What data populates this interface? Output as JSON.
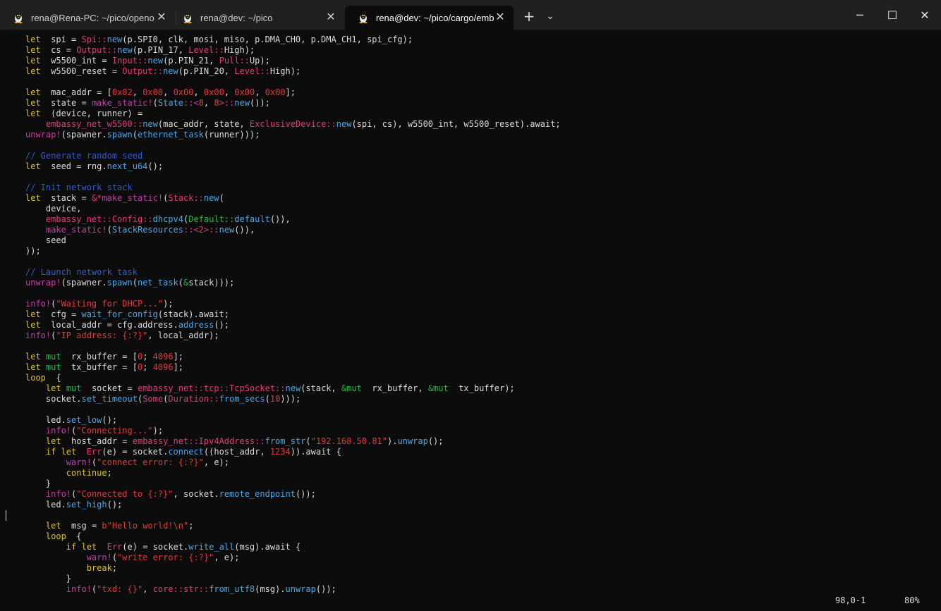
{
  "tabs": [
    {
      "title": "rena@Rena-PC: ~/pico/openo",
      "icon": "linux-penguin-icon",
      "active": false
    },
    {
      "title": "rena@dev: ~/pico",
      "icon": "linux-penguin-icon",
      "active": false
    },
    {
      "title": "rena@dev: ~/pico/cargo/emb",
      "icon": "linux-penguin-icon",
      "active": true
    }
  ],
  "toolbar": {
    "new_tab": "+",
    "dropdown": "⌄"
  },
  "window": {
    "minimize": "─",
    "maximize": "☐",
    "close": "✕"
  },
  "code_lines": [
    [
      [
        "kw",
        "let"
      ],
      [
        "",
        "  spi = "
      ],
      [
        "ty",
        "Spi::"
      ],
      [
        "fn",
        "new"
      ],
      [
        "",
        "(p.SPI0, clk, mosi, miso, p.DMA_CH0, p.DMA_CH1, spi_cfg);"
      ]
    ],
    [
      [
        "kw",
        "let"
      ],
      [
        "",
        "  cs = "
      ],
      [
        "ty",
        "Output::"
      ],
      [
        "fn",
        "new"
      ],
      [
        "",
        "(p.PIN_17, "
      ],
      [
        "ty",
        "Level::"
      ],
      [
        "",
        "High);"
      ]
    ],
    [
      [
        "kw",
        "let"
      ],
      [
        "",
        "  w5500_int = "
      ],
      [
        "ty",
        "Input::"
      ],
      [
        "fn",
        "new"
      ],
      [
        "",
        "(p.PIN_21, "
      ],
      [
        "ty",
        "Pull::"
      ],
      [
        "",
        "Up);"
      ]
    ],
    [
      [
        "kw",
        "let"
      ],
      [
        "",
        "  w5500_reset = "
      ],
      [
        "ty",
        "Output::"
      ],
      [
        "fn",
        "new"
      ],
      [
        "",
        "(p.PIN_20, "
      ],
      [
        "ty",
        "Level::"
      ],
      [
        "",
        "High);"
      ]
    ],
    [],
    [
      [
        "kw",
        "let"
      ],
      [
        "",
        "  mac_addr = ["
      ],
      [
        "num",
        "0x02"
      ],
      [
        "",
        ", "
      ],
      [
        "num",
        "0x00"
      ],
      [
        "",
        ", "
      ],
      [
        "num",
        "0x00"
      ],
      [
        "",
        ", "
      ],
      [
        "num",
        "0x00"
      ],
      [
        "",
        ", "
      ],
      [
        "num",
        "0x00"
      ],
      [
        "",
        ", "
      ],
      [
        "num",
        "0x00"
      ],
      [
        "",
        "];"
      ]
    ],
    [
      [
        "kw",
        "let"
      ],
      [
        "",
        "  state = "
      ],
      [
        "mac",
        "make_static!"
      ],
      [
        "",
        "("
      ],
      [
        "fn",
        "State"
      ],
      [
        "ty",
        "::<"
      ],
      [
        "num",
        "8"
      ],
      [
        "",
        ", "
      ],
      [
        "num",
        "8"
      ],
      [
        "ty",
        ">::"
      ],
      [
        "fn",
        "new"
      ],
      [
        "",
        "());"
      ]
    ],
    [
      [
        "kw",
        "let"
      ],
      [
        "",
        "  (device, runner) ="
      ]
    ],
    [
      [
        "",
        "    "
      ],
      [
        "ty",
        "embassy_net_w5500::"
      ],
      [
        "fn",
        "new"
      ],
      [
        "",
        "(mac_addr, state, "
      ],
      [
        "ty",
        "ExclusiveDevice::"
      ],
      [
        "fn",
        "new"
      ],
      [
        "",
        "(spi, cs), w5500_int, w5500_reset).await;"
      ]
    ],
    [
      [
        "mac",
        "unwrap!"
      ],
      [
        "",
        "(spawner."
      ],
      [
        "fn",
        "spawn"
      ],
      [
        "",
        "("
      ],
      [
        "fn",
        "ethernet_task"
      ],
      [
        "",
        "(runner)));"
      ]
    ],
    [],
    [
      [
        "cm",
        "// Generate random seed"
      ]
    ],
    [
      [
        "kw",
        "let"
      ],
      [
        "",
        "  seed = rng."
      ],
      [
        "fn",
        "next_u64"
      ],
      [
        "",
        "();"
      ]
    ],
    [],
    [
      [
        "cm",
        "// Init network stack"
      ]
    ],
    [
      [
        "kw",
        "let"
      ],
      [
        "",
        "  stack = "
      ],
      [
        "ty",
        "&*"
      ],
      [
        "mac",
        "make_static!"
      ],
      [
        "",
        "("
      ],
      [
        "ty",
        "Stack::"
      ],
      [
        "fn",
        "new"
      ],
      [
        "",
        "("
      ]
    ],
    [
      [
        "",
        "    device,"
      ]
    ],
    [
      [
        "",
        "    "
      ],
      [
        "ty",
        "embassy_net::Config::"
      ],
      [
        "fn",
        "dhcpv4"
      ],
      [
        "",
        "("
      ],
      [
        "grn",
        "Default::"
      ],
      [
        "fn",
        "default"
      ],
      [
        "",
        "()),"
      ]
    ],
    [
      [
        "",
        "    "
      ],
      [
        "mac",
        "make_static!"
      ],
      [
        "",
        "("
      ],
      [
        "fn",
        "StackResources"
      ],
      [
        "ty",
        "::<"
      ],
      [
        "num",
        "2"
      ],
      [
        "ty",
        ">::"
      ],
      [
        "fn",
        "new"
      ],
      [
        "",
        "()),"
      ]
    ],
    [
      [
        "",
        "    seed"
      ]
    ],
    [
      [
        "",
        "));"
      ]
    ],
    [],
    [
      [
        "cm",
        "// Launch network task"
      ]
    ],
    [
      [
        "mac",
        "unwrap!"
      ],
      [
        "",
        "(spawner."
      ],
      [
        "fn",
        "spawn"
      ],
      [
        "",
        "("
      ],
      [
        "fn",
        "net_task"
      ],
      [
        "",
        "("
      ],
      [
        "grn",
        "&"
      ],
      [
        "",
        "stack)));"
      ]
    ],
    [],
    [
      [
        "mac",
        "info!"
      ],
      [
        "",
        "("
      ],
      [
        "str",
        "\"Waiting for DHCP...\""
      ],
      [
        "",
        ");"
      ]
    ],
    [
      [
        "kw",
        "let"
      ],
      [
        "",
        "  cfg = "
      ],
      [
        "fn",
        "wait_for_config"
      ],
      [
        "",
        "(stack).await;"
      ]
    ],
    [
      [
        "kw",
        "let"
      ],
      [
        "",
        "  local_addr = cfg.address."
      ],
      [
        "fn",
        "address"
      ],
      [
        "",
        "();"
      ]
    ],
    [
      [
        "mac",
        "info!"
      ],
      [
        "",
        "("
      ],
      [
        "str",
        "\"IP address: {:?}\""
      ],
      [
        "",
        ", local_addr);"
      ]
    ],
    [],
    [
      [
        "kw",
        "let"
      ],
      [
        "",
        ""
      ],
      [
        "grn",
        " mut"
      ],
      [
        "",
        "  rx_buffer = ["
      ],
      [
        "num",
        "0"
      ],
      [
        "",
        "; "
      ],
      [
        "num",
        "4096"
      ],
      [
        "",
        "];"
      ]
    ],
    [
      [
        "kw",
        "let"
      ],
      [
        "",
        ""
      ],
      [
        "grn",
        " mut"
      ],
      [
        "",
        "  tx_buffer = ["
      ],
      [
        "num",
        "0"
      ],
      [
        "",
        "; "
      ],
      [
        "num",
        "4096"
      ],
      [
        "",
        "];"
      ]
    ],
    [
      [
        "kw",
        "loop"
      ],
      [
        "",
        "  {"
      ]
    ],
    [
      [
        "",
        "    "
      ],
      [
        "kw",
        "let"
      ],
      [
        "grn",
        " mut"
      ],
      [
        "",
        "  socket = "
      ],
      [
        "ty",
        "embassy_net::tcp::TcpSocket::"
      ],
      [
        "fn",
        "new"
      ],
      [
        "",
        "(stack, "
      ],
      [
        "grn",
        "&mut"
      ],
      [
        "",
        "  rx_buffer, "
      ],
      [
        "grn",
        "&mut"
      ],
      [
        "",
        "  tx_buffer);"
      ]
    ],
    [
      [
        "",
        "    socket."
      ],
      [
        "fn",
        "set_timeout"
      ],
      [
        "",
        "("
      ],
      [
        "ty",
        "Some"
      ],
      [
        "",
        "("
      ],
      [
        "ty",
        "Duration::"
      ],
      [
        "fn",
        "from_secs"
      ],
      [
        "",
        "("
      ],
      [
        "num",
        "10"
      ],
      [
        "",
        ")));"
      ]
    ],
    [],
    [
      [
        "",
        "    led."
      ],
      [
        "fn",
        "set_low"
      ],
      [
        "",
        "();"
      ]
    ],
    [
      [
        "",
        "    "
      ],
      [
        "mac",
        "info!"
      ],
      [
        "",
        "("
      ],
      [
        "str",
        "\"Connecting...\""
      ],
      [
        "",
        ");"
      ]
    ],
    [
      [
        "",
        "    "
      ],
      [
        "kw",
        "let"
      ],
      [
        "",
        "  host_addr = "
      ],
      [
        "ty",
        "embassy_net::Ipv4Address::"
      ],
      [
        "fn",
        "from_str"
      ],
      [
        "",
        "("
      ],
      [
        "str",
        "\"192.168.50.81\""
      ],
      [
        "",
        ")."
      ],
      [
        "fn",
        "unwrap"
      ],
      [
        "",
        "();"
      ]
    ],
    [
      [
        "",
        "    "
      ],
      [
        "kw",
        "if let"
      ],
      [
        "",
        "  "
      ],
      [
        "ty",
        "Err"
      ],
      [
        "",
        "(e) = socket."
      ],
      [
        "fn",
        "connect"
      ],
      [
        "",
        "((host_addr, "
      ],
      [
        "num",
        "1234"
      ],
      [
        "",
        "))"
      ],
      [
        "",
        ".await {"
      ]
    ],
    [
      [
        "",
        "        "
      ],
      [
        "mac",
        "warn!"
      ],
      [
        "",
        "("
      ],
      [
        "str",
        "\"connect error: {:?}\""
      ],
      [
        "",
        ", e);"
      ]
    ],
    [
      [
        "",
        "        "
      ],
      [
        "kw",
        "continue"
      ],
      [
        "",
        ";"
      ]
    ],
    [
      [
        "",
        "    }"
      ]
    ],
    [
      [
        "",
        "    "
      ],
      [
        "mac",
        "info!"
      ],
      [
        "",
        "("
      ],
      [
        "str",
        "\"Connected to {:?}\""
      ],
      [
        "",
        ", socket."
      ],
      [
        "fn",
        "remote_endpoint"
      ],
      [
        "",
        "());"
      ]
    ],
    [
      [
        "",
        "    led."
      ],
      [
        "fn",
        "set_high"
      ],
      [
        "",
        "();"
      ]
    ],
    [],
    [
      [
        "",
        "    "
      ],
      [
        "kw",
        "let"
      ],
      [
        "",
        "  msg = "
      ],
      [
        "str",
        "b\"Hello world!\\n\""
      ],
      [
        "",
        ";"
      ]
    ],
    [
      [
        "",
        "    "
      ],
      [
        "kw",
        "loop"
      ],
      [
        "",
        "  {"
      ]
    ],
    [
      [
        "",
        "        "
      ],
      [
        "kw",
        "if let"
      ],
      [
        "",
        "  "
      ],
      [
        "ty",
        "Err"
      ],
      [
        "",
        "(e) = socket."
      ],
      [
        "fn",
        "write_all"
      ],
      [
        "",
        "(msg).await {"
      ]
    ],
    [
      [
        "",
        "            "
      ],
      [
        "mac",
        "warn!"
      ],
      [
        "",
        "("
      ],
      [
        "str",
        "\"write error: {:?}\""
      ],
      [
        "",
        ", e);"
      ]
    ],
    [
      [
        "",
        "            "
      ],
      [
        "kw",
        "break"
      ],
      [
        "",
        ";"
      ]
    ],
    [
      [
        "",
        "        }"
      ]
    ],
    [
      [
        "",
        "        "
      ],
      [
        "mac",
        "info!"
      ],
      [
        "",
        "("
      ],
      [
        "str",
        "\"txd: {}\""
      ],
      [
        "",
        ", "
      ],
      [
        "ty",
        "core::str::"
      ],
      [
        "fn",
        "from_utf8"
      ],
      [
        "",
        "(msg)."
      ],
      [
        "fn",
        "unwrap"
      ],
      [
        "",
        "());"
      ]
    ]
  ],
  "status": {
    "position": "98,0-1",
    "percent": "80%"
  }
}
